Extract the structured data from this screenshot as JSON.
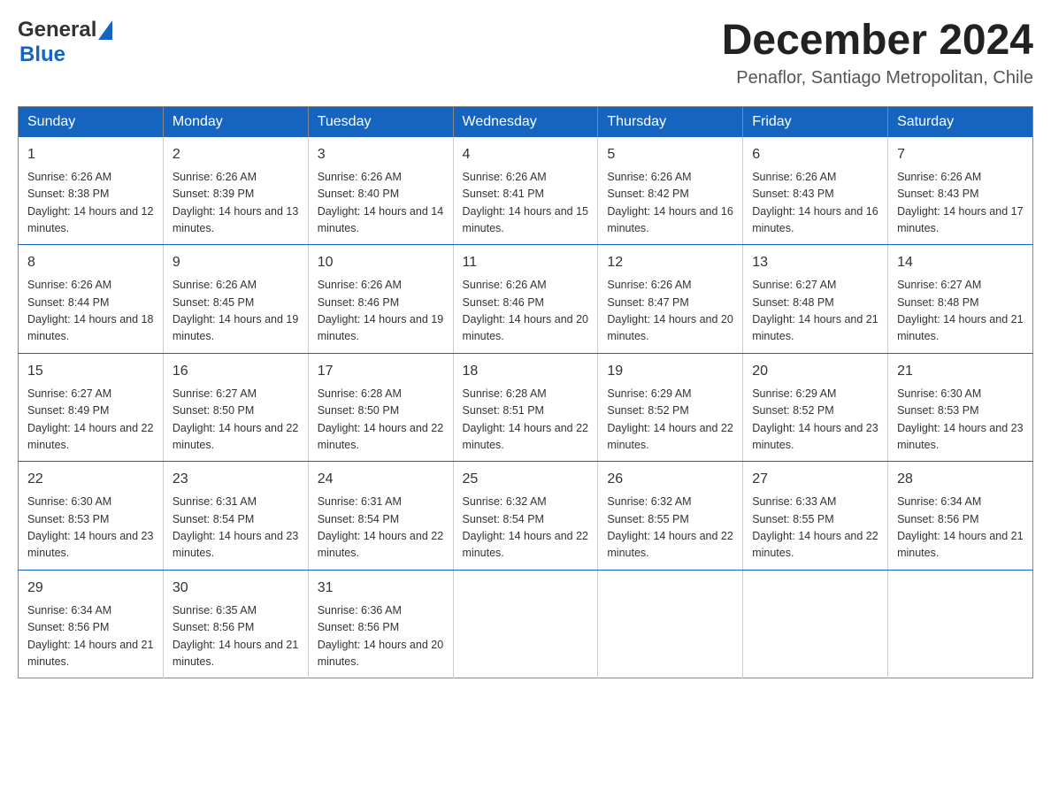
{
  "header": {
    "logo": {
      "general": "General",
      "blue": "Blue"
    },
    "month_title": "December 2024",
    "location": "Penaflor, Santiago Metropolitan, Chile"
  },
  "days_of_week": [
    "Sunday",
    "Monday",
    "Tuesday",
    "Wednesday",
    "Thursday",
    "Friday",
    "Saturday"
  ],
  "weeks": [
    [
      {
        "day": 1,
        "sunrise": "6:26 AM",
        "sunset": "8:38 PM",
        "daylight": "14 hours and 12 minutes."
      },
      {
        "day": 2,
        "sunrise": "6:26 AM",
        "sunset": "8:39 PM",
        "daylight": "14 hours and 13 minutes."
      },
      {
        "day": 3,
        "sunrise": "6:26 AM",
        "sunset": "8:40 PM",
        "daylight": "14 hours and 14 minutes."
      },
      {
        "day": 4,
        "sunrise": "6:26 AM",
        "sunset": "8:41 PM",
        "daylight": "14 hours and 15 minutes."
      },
      {
        "day": 5,
        "sunrise": "6:26 AM",
        "sunset": "8:42 PM",
        "daylight": "14 hours and 16 minutes."
      },
      {
        "day": 6,
        "sunrise": "6:26 AM",
        "sunset": "8:43 PM",
        "daylight": "14 hours and 16 minutes."
      },
      {
        "day": 7,
        "sunrise": "6:26 AM",
        "sunset": "8:43 PM",
        "daylight": "14 hours and 17 minutes."
      }
    ],
    [
      {
        "day": 8,
        "sunrise": "6:26 AM",
        "sunset": "8:44 PM",
        "daylight": "14 hours and 18 minutes."
      },
      {
        "day": 9,
        "sunrise": "6:26 AM",
        "sunset": "8:45 PM",
        "daylight": "14 hours and 19 minutes."
      },
      {
        "day": 10,
        "sunrise": "6:26 AM",
        "sunset": "8:46 PM",
        "daylight": "14 hours and 19 minutes."
      },
      {
        "day": 11,
        "sunrise": "6:26 AM",
        "sunset": "8:46 PM",
        "daylight": "14 hours and 20 minutes."
      },
      {
        "day": 12,
        "sunrise": "6:26 AM",
        "sunset": "8:47 PM",
        "daylight": "14 hours and 20 minutes."
      },
      {
        "day": 13,
        "sunrise": "6:27 AM",
        "sunset": "8:48 PM",
        "daylight": "14 hours and 21 minutes."
      },
      {
        "day": 14,
        "sunrise": "6:27 AM",
        "sunset": "8:48 PM",
        "daylight": "14 hours and 21 minutes."
      }
    ],
    [
      {
        "day": 15,
        "sunrise": "6:27 AM",
        "sunset": "8:49 PM",
        "daylight": "14 hours and 22 minutes."
      },
      {
        "day": 16,
        "sunrise": "6:27 AM",
        "sunset": "8:50 PM",
        "daylight": "14 hours and 22 minutes."
      },
      {
        "day": 17,
        "sunrise": "6:28 AM",
        "sunset": "8:50 PM",
        "daylight": "14 hours and 22 minutes."
      },
      {
        "day": 18,
        "sunrise": "6:28 AM",
        "sunset": "8:51 PM",
        "daylight": "14 hours and 22 minutes."
      },
      {
        "day": 19,
        "sunrise": "6:29 AM",
        "sunset": "8:52 PM",
        "daylight": "14 hours and 22 minutes."
      },
      {
        "day": 20,
        "sunrise": "6:29 AM",
        "sunset": "8:52 PM",
        "daylight": "14 hours and 23 minutes."
      },
      {
        "day": 21,
        "sunrise": "6:30 AM",
        "sunset": "8:53 PM",
        "daylight": "14 hours and 23 minutes."
      }
    ],
    [
      {
        "day": 22,
        "sunrise": "6:30 AM",
        "sunset": "8:53 PM",
        "daylight": "14 hours and 23 minutes."
      },
      {
        "day": 23,
        "sunrise": "6:31 AM",
        "sunset": "8:54 PM",
        "daylight": "14 hours and 23 minutes."
      },
      {
        "day": 24,
        "sunrise": "6:31 AM",
        "sunset": "8:54 PM",
        "daylight": "14 hours and 22 minutes."
      },
      {
        "day": 25,
        "sunrise": "6:32 AM",
        "sunset": "8:54 PM",
        "daylight": "14 hours and 22 minutes."
      },
      {
        "day": 26,
        "sunrise": "6:32 AM",
        "sunset": "8:55 PM",
        "daylight": "14 hours and 22 minutes."
      },
      {
        "day": 27,
        "sunrise": "6:33 AM",
        "sunset": "8:55 PM",
        "daylight": "14 hours and 22 minutes."
      },
      {
        "day": 28,
        "sunrise": "6:34 AM",
        "sunset": "8:56 PM",
        "daylight": "14 hours and 21 minutes."
      }
    ],
    [
      {
        "day": 29,
        "sunrise": "6:34 AM",
        "sunset": "8:56 PM",
        "daylight": "14 hours and 21 minutes."
      },
      {
        "day": 30,
        "sunrise": "6:35 AM",
        "sunset": "8:56 PM",
        "daylight": "14 hours and 21 minutes."
      },
      {
        "day": 31,
        "sunrise": "6:36 AM",
        "sunset": "8:56 PM",
        "daylight": "14 hours and 20 minutes."
      },
      null,
      null,
      null,
      null
    ]
  ],
  "labels": {
    "sunrise": "Sunrise:",
    "sunset": "Sunset:",
    "daylight": "Daylight:"
  }
}
